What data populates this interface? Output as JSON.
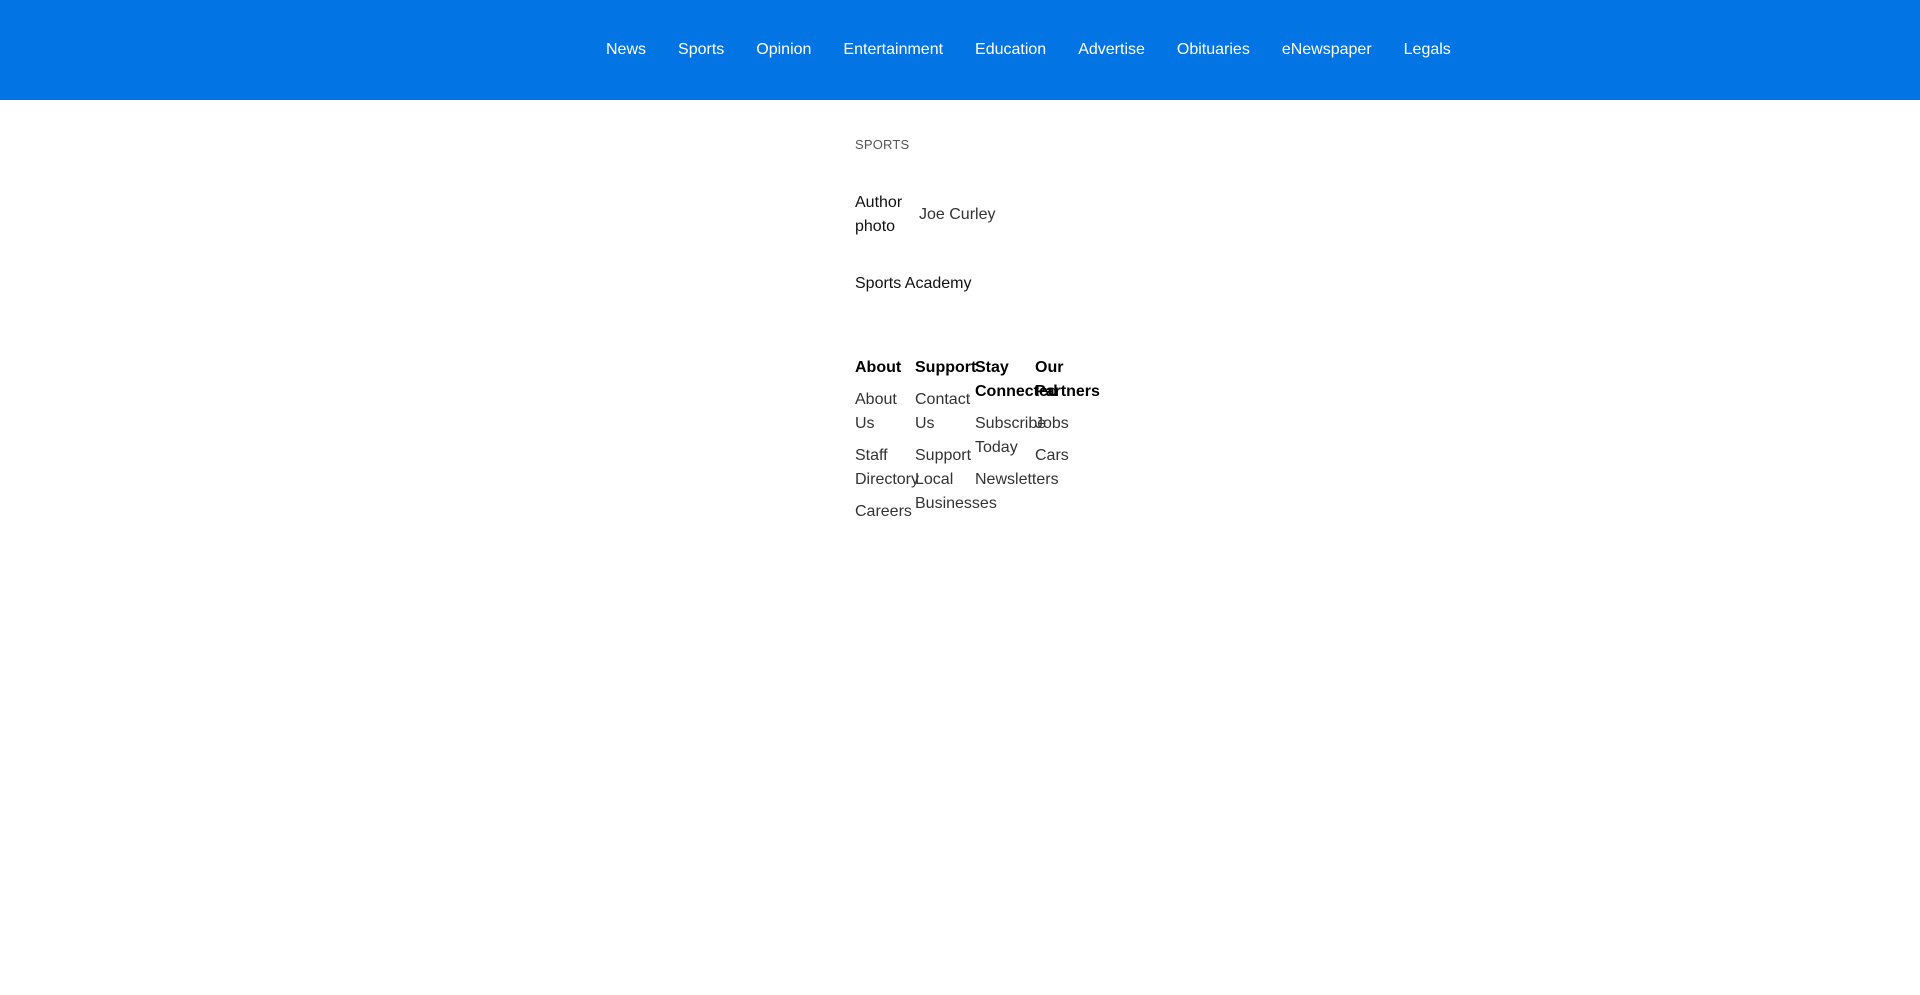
{
  "nav": {
    "items": [
      "News",
      "Sports",
      "Opinion",
      "Entertainment",
      "Education",
      "Advertise",
      "Obituaries",
      "eNewspaper",
      "Legals"
    ]
  },
  "article": {
    "section": "SPORTS",
    "author_photo_alt": "Author photo",
    "author_name": "Joe Curley",
    "headline": "Sports Academy"
  },
  "footer": {
    "columns": [
      {
        "heading": "About",
        "links": [
          "About Us",
          "Staff Directory",
          "Careers"
        ]
      },
      {
        "heading": "Support",
        "links": [
          "Contact Us",
          "Support Local Businesses"
        ]
      },
      {
        "heading": "Stay Connected",
        "links": [
          "Subscribe Today",
          "Newsletters"
        ]
      },
      {
        "heading": "Our Partners",
        "links": [
          "Jobs",
          "Cars"
        ]
      }
    ]
  },
  "colors": {
    "topbar": "#0374e3"
  }
}
